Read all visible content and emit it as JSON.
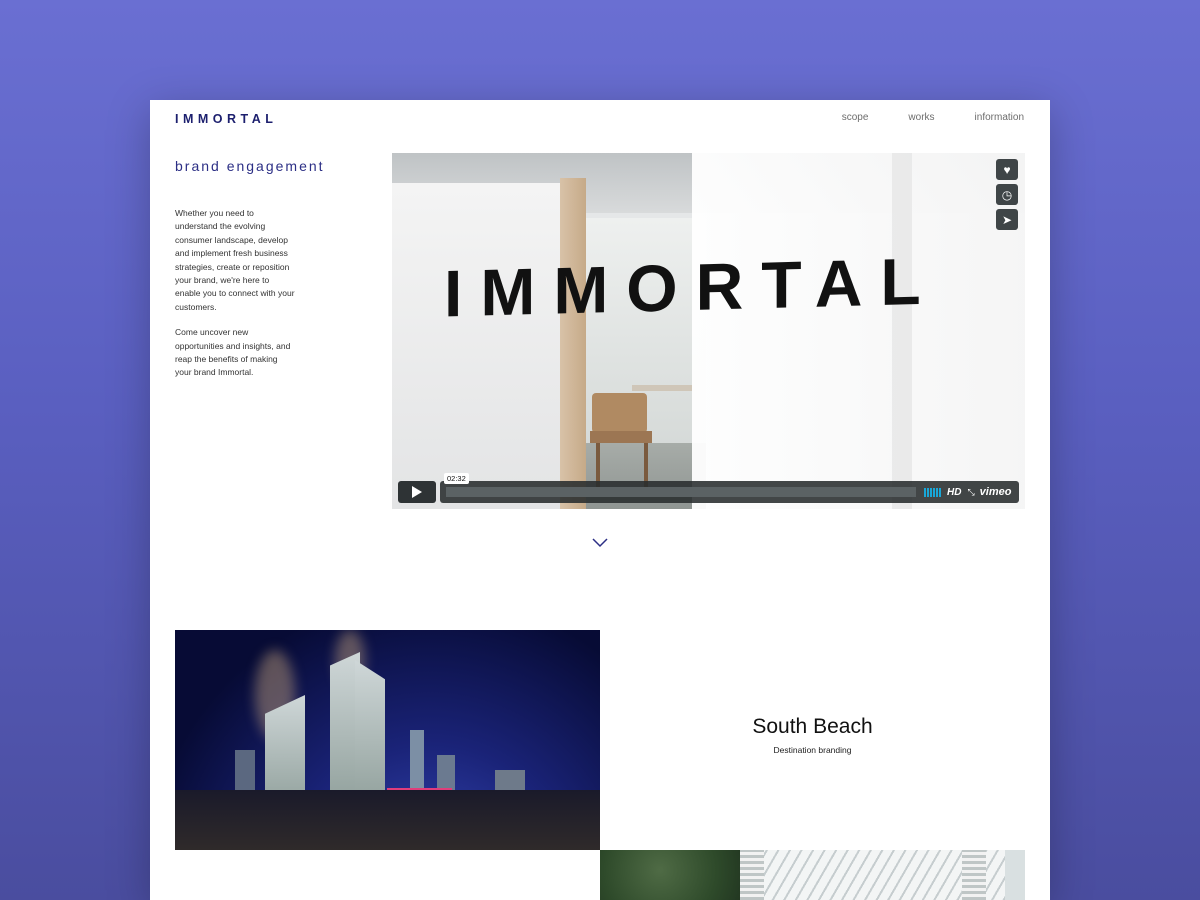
{
  "header": {
    "logo": "IMMORTAL",
    "nav": [
      "scope",
      "works",
      "information"
    ]
  },
  "intro": {
    "headline": "brand engagement",
    "paragraph1": "Whether you need to understand the evolving consumer landscape, develop and implement fresh business strategies, create or reposition your brand, we're here to enable you to connect with your customers.",
    "paragraph2": "Come uncover new opportunities and insights, and reap the benefits of making your brand Immortal."
  },
  "video": {
    "overlay_title": "IMMORTAL",
    "timestamp": "02:32",
    "hd_label": "HD",
    "provider": "vimeo",
    "side_buttons": [
      "heart-icon",
      "clock-icon",
      "send-icon"
    ],
    "volume_color": "#19a7d8"
  },
  "project": {
    "title": "South Beach",
    "subtitle": "Destination branding"
  },
  "colors": {
    "brand": "#1c1f6e",
    "background": "#6a6fd2"
  }
}
